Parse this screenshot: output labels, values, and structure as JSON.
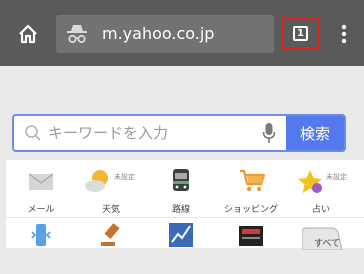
{
  "browser": {
    "url": "m.yahoo.co.jp",
    "tab_count": "1"
  },
  "search": {
    "placeholder": "キーワードを入力",
    "button_label": "検索"
  },
  "services": [
    {
      "label": "メール",
      "icon": "mail-icon"
    },
    {
      "label": "天気",
      "badge": "未設定",
      "icon": "weather-icon"
    },
    {
      "label": "路線",
      "icon": "train-icon"
    },
    {
      "label": "ショッピング",
      "icon": "shopping-cart-icon"
    },
    {
      "label": "占い",
      "badge": "未設定",
      "icon": "star-icon"
    }
  ],
  "services_row2": [
    {
      "icon": "phone-icon"
    },
    {
      "icon": "auction-icon"
    },
    {
      "icon": "stocks-icon"
    },
    {
      "icon": "news-icon"
    },
    {
      "label": "すべて",
      "icon": "all-services-icon"
    }
  ]
}
